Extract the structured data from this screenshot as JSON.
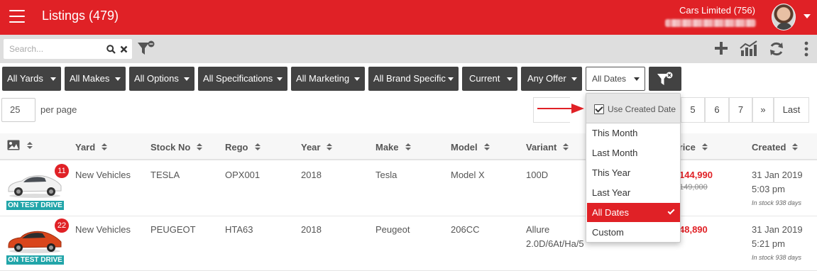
{
  "header": {
    "title": "Listings (479)",
    "company": "Cars Limited (756)"
  },
  "toolbar": {
    "search_placeholder": "Search..."
  },
  "filters": [
    "All Yards",
    "All Makes",
    "All Options",
    "All Specifications",
    "All Marketing",
    "All Brand Specific",
    "Current",
    "Any Offer"
  ],
  "date_filter": {
    "selected": "All Dates",
    "use_created_date": "Use Created Date",
    "options": [
      "This Month",
      "Last Month",
      "This Year",
      "Last Year",
      "All Dates",
      "Custom"
    ]
  },
  "paging": {
    "per_page_value": "25",
    "per_page_label": "per page",
    "pages": [
      "5",
      "6",
      "7",
      "»",
      "Last"
    ]
  },
  "table": {
    "columns": [
      "Yard",
      "Stock No",
      "Rego",
      "Year",
      "Make",
      "Model",
      "Variant",
      "Price",
      "Created"
    ],
    "rows": [
      {
        "badge": "11",
        "tag": "ON TEST DRIVE",
        "yard": "New Vehicles",
        "stock": "TESLA",
        "rego": "OPX001",
        "year": "2018",
        "make": "Tesla",
        "model": "Model X",
        "variant": "100D",
        "variant2": "",
        "price": "144,990",
        "old_price": "149,000",
        "created_date": "31 Jan 2019",
        "created_time": "5:03 pm",
        "in_stock": "In stock 938 days"
      },
      {
        "badge": "22",
        "tag": "ON TEST DRIVE",
        "yard": "New Vehicles",
        "stock": "PEUGEOT",
        "rego": "HTA63",
        "year": "2018",
        "make": "Peugeot",
        "model": "206CC",
        "variant": "Allure",
        "variant2": "2.0D/6At/Ha/5",
        "price": "48,890",
        "old_price": "",
        "created_date": "31 Jan 2019",
        "created_time": "5:21 pm",
        "in_stock": "In stock 938 days"
      }
    ]
  },
  "colors": {
    "brand_red": "#e02126",
    "dark_button": "#424242",
    "test_drive_teal": "#21a5a9"
  }
}
